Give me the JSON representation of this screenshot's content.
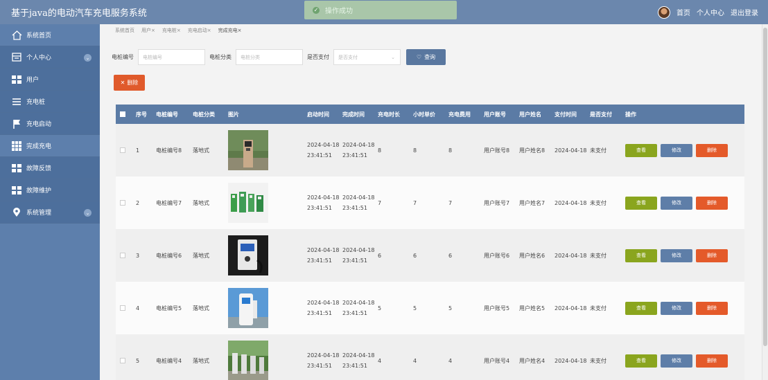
{
  "header": {
    "title": "基于java的电动汽车充电服务系统",
    "toast": "操作成功",
    "links": [
      "首页",
      "个人中心",
      "退出登录"
    ]
  },
  "sidebar": {
    "items": [
      {
        "label": "系统首页",
        "icon": "home-icon"
      },
      {
        "label": "个人中心",
        "icon": "profile-icon",
        "expandable": true
      },
      {
        "label": "用户",
        "icon": "grid-icon"
      },
      {
        "label": "充电桩",
        "icon": "list-icon"
      },
      {
        "label": "充电启动",
        "icon": "flag-icon"
      },
      {
        "label": "完成充电",
        "icon": "grid9-icon"
      },
      {
        "label": "故障反馈",
        "icon": "grid-icon"
      },
      {
        "label": "故障维护",
        "icon": "grid-icon"
      },
      {
        "label": "系统管理",
        "icon": "location-icon",
        "expandable": true
      }
    ]
  },
  "breadcrumb": [
    "系统首页",
    "用户×",
    "充电桩×",
    "充电启动×",
    "完成充电×"
  ],
  "search": {
    "f1_label": "电桩编号",
    "f1_placeholder": "电桩编号",
    "f2_label": "电桩分类",
    "f2_placeholder": "电桩分类",
    "f3_label": "是否支付",
    "f3_placeholder": "是否支付",
    "query_label": "查询"
  },
  "actions": {
    "delete_label": "删除"
  },
  "table": {
    "headers": [
      "序号",
      "电桩编号",
      "电桩分类",
      "图片",
      "启动时间",
      "完成时间",
      "充电时长",
      "小时单价",
      "充电费用",
      "用户账号",
      "用户姓名",
      "支付时间",
      "是否支付",
      "操作"
    ],
    "rows": [
      {
        "idx": "1",
        "no": "电桩编号8",
        "cat": "落地式",
        "start": "2024-04-18 23:41:51",
        "end": "2024-04-18 23:41:51",
        "dur": "8",
        "price": "8",
        "fee": "8",
        "acct": "用户账号8",
        "name": "用户姓名8",
        "pay": "2024-04-18",
        "paid": "未支付"
      },
      {
        "idx": "2",
        "no": "电桩编号7",
        "cat": "落地式",
        "start": "2024-04-18 23:41:51",
        "end": "2024-04-18 23:41:51",
        "dur": "7",
        "price": "7",
        "fee": "7",
        "acct": "用户账号7",
        "name": "用户姓名7",
        "pay": "2024-04-18",
        "paid": "未支付"
      },
      {
        "idx": "3",
        "no": "电桩编号6",
        "cat": "落地式",
        "start": "2024-04-18 23:41:51",
        "end": "2024-04-18 23:41:51",
        "dur": "6",
        "price": "6",
        "fee": "6",
        "acct": "用户账号6",
        "name": "用户姓名6",
        "pay": "2024-04-18",
        "paid": "未支付"
      },
      {
        "idx": "4",
        "no": "电桩编号5",
        "cat": "落地式",
        "start": "2024-04-18 23:41:51",
        "end": "2024-04-18 23:41:51",
        "dur": "5",
        "price": "5",
        "fee": "5",
        "acct": "用户账号5",
        "name": "用户姓名5",
        "pay": "2024-04-18",
        "paid": "未支付"
      },
      {
        "idx": "5",
        "no": "电桩编号4",
        "cat": "落地式",
        "start": "2024-04-18 23:41:51",
        "end": "2024-04-18 23:41:51",
        "dur": "4",
        "price": "4",
        "fee": "4",
        "acct": "用户账号4",
        "name": "用户姓名4",
        "pay": "2024-04-18",
        "paid": "未支付"
      }
    ],
    "ops": {
      "view": "查看",
      "edit": "修改",
      "delete": "删除"
    }
  }
}
